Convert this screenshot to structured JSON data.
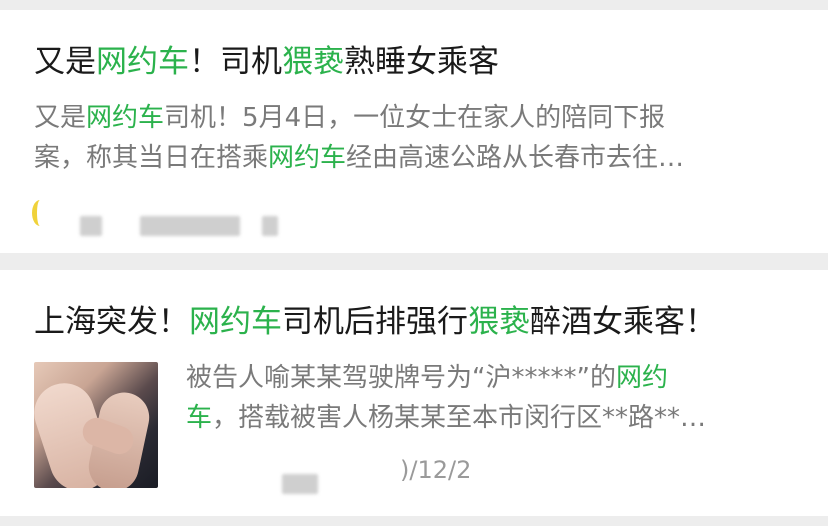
{
  "articles": [
    {
      "title_parts": [
        {
          "text": "又是",
          "highlight": false
        },
        {
          "text": "网约车",
          "highlight": true
        },
        {
          "text": "！司机",
          "highlight": false
        },
        {
          "text": "猥亵",
          "highlight": true
        },
        {
          "text": "熟睡女乘客",
          "highlight": false
        }
      ],
      "summary_line1": [
        {
          "text": "又是",
          "highlight": false
        },
        {
          "text": "网约车",
          "highlight": true
        },
        {
          "text": "司机！5月4日，一位女士在家人的陪同下报",
          "highlight": false
        }
      ],
      "summary_line2": [
        {
          "text": "案，称其当日在搭乘",
          "highlight": false
        },
        {
          "text": "网约车",
          "highlight": true
        },
        {
          "text": "经由高速公路从长春市去往…",
          "highlight": false
        }
      ]
    },
    {
      "title_parts": [
        {
          "text": "上海突发！",
          "highlight": false
        },
        {
          "text": "网约车",
          "highlight": true
        },
        {
          "text": "司机后排强行",
          "highlight": false
        },
        {
          "text": "猥亵",
          "highlight": true
        },
        {
          "text": "醉酒女乘客！",
          "highlight": false
        }
      ],
      "summary_line1": [
        {
          "text": "被告人喻某某驾驶牌号为“沪*****”的",
          "highlight": false
        },
        {
          "text": "网约",
          "highlight": true
        }
      ],
      "summary_line2": [
        {
          "text": "车",
          "highlight": true
        },
        {
          "text": "，搭载被害人杨某某至本市闵行区**路**…",
          "highlight": false
        }
      ],
      "date_fragment": ")/12/2"
    }
  ],
  "colors": {
    "highlight": "#2bb24c",
    "background": "#ededed",
    "card": "#ffffff"
  }
}
